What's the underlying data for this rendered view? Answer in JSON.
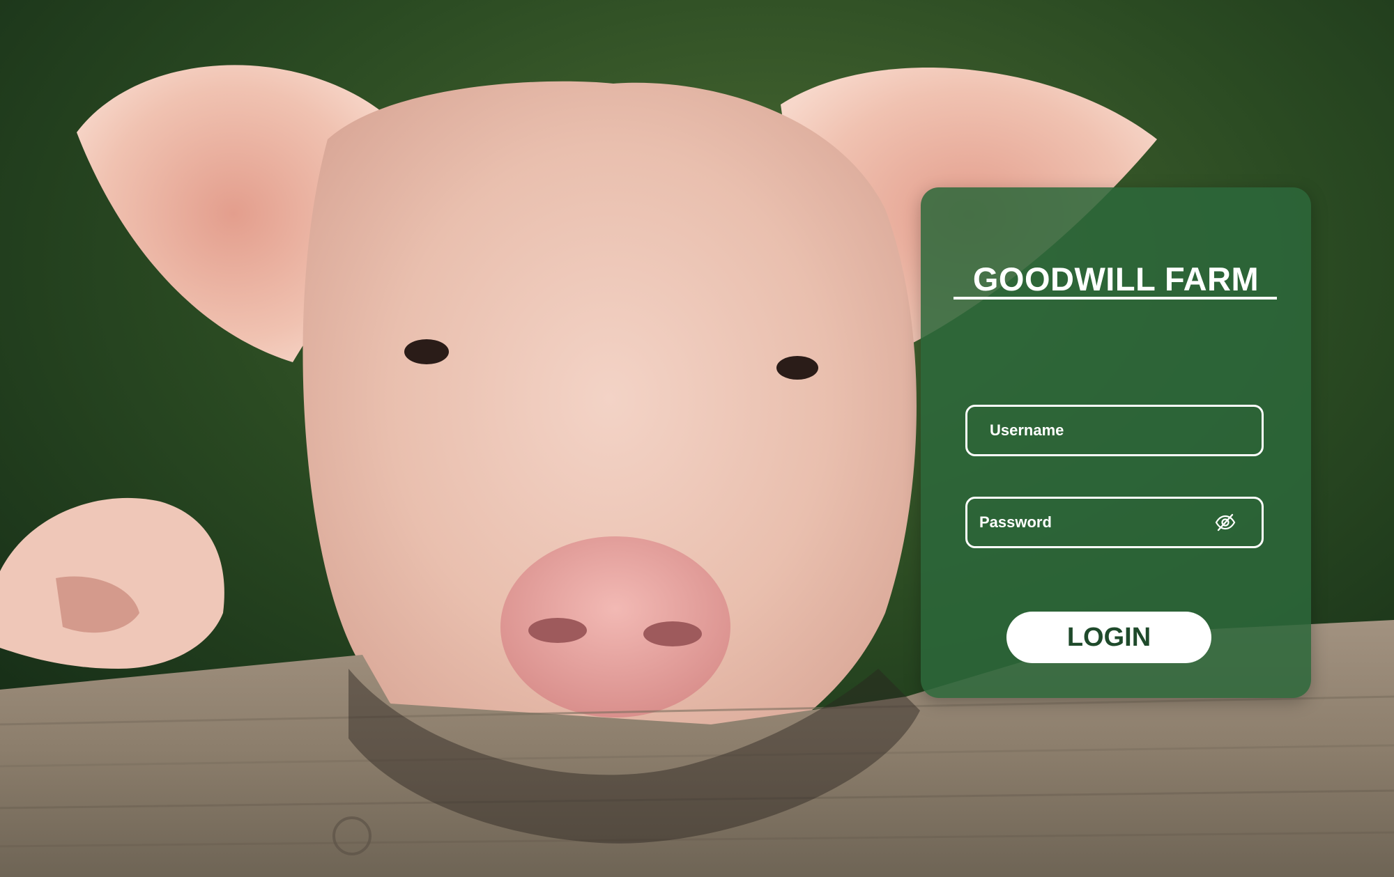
{
  "brand": {
    "title": "GOODWILL FARM"
  },
  "form": {
    "username_placeholder": "Username",
    "password_placeholder": "Password",
    "login_label": "LOGIN",
    "password_toggle_icon": "eye-slash-icon"
  },
  "colors": {
    "card": "#2C683A",
    "button_text": "#1F4A2B",
    "text": "#FFFFFF"
  },
  "background": {
    "subject": "pig-photo"
  }
}
